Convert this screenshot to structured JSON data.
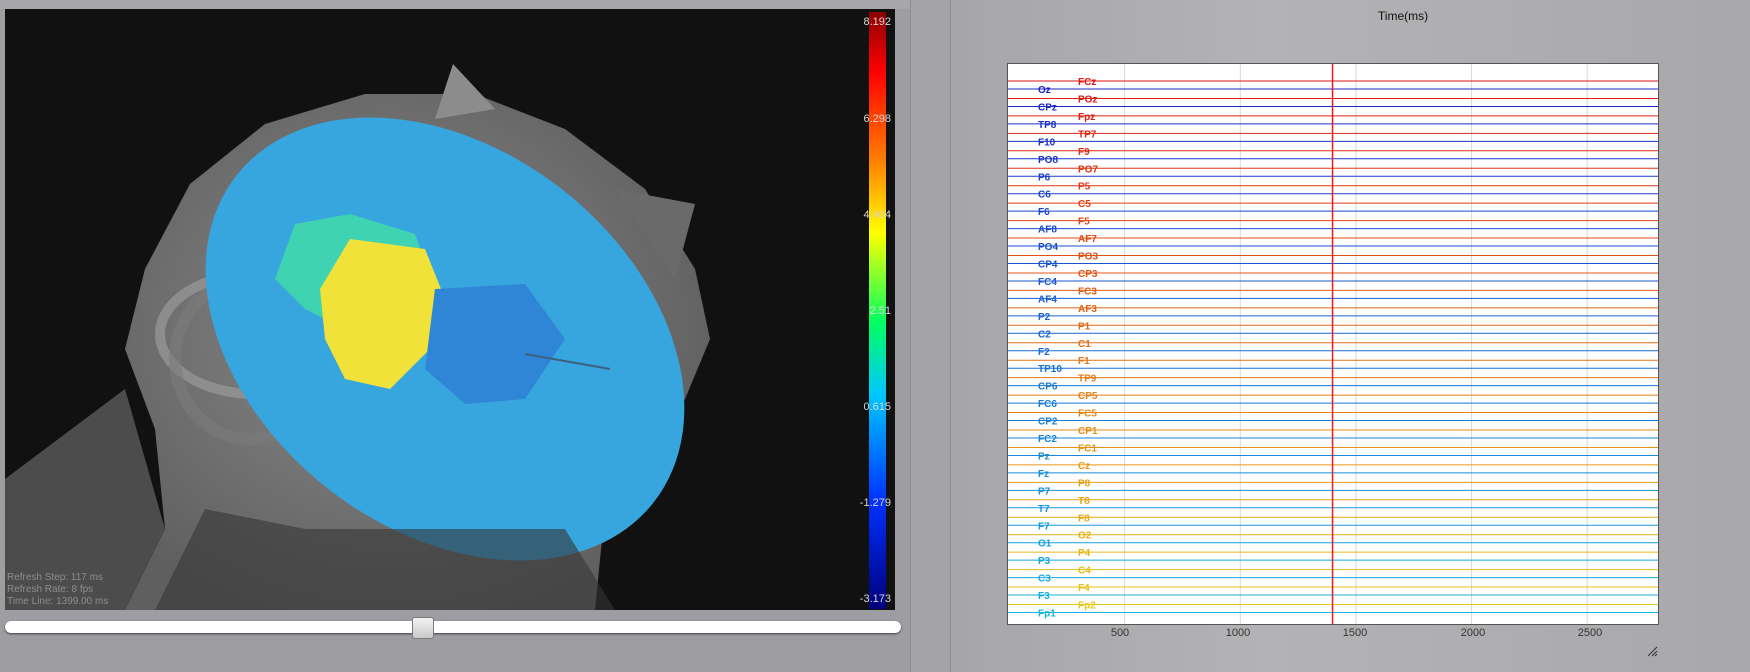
{
  "viewport": {
    "colorbar": {
      "max_label": "8.192",
      "labels": [
        "8.192",
        "6.298",
        "4.404",
        "2.51",
        "0.615",
        "-1.279",
        "-3.173"
      ]
    },
    "info": {
      "refresh_step": "Refresh Step: 117 ms",
      "refresh_rate": "Refresh Rate: 8 fps",
      "time_line": "Time Line: 1399.00 ms"
    }
  },
  "time_slider": {
    "position_fraction": 0.465
  },
  "plot": {
    "title": "Time(ms)",
    "x_ticks": [
      "500",
      "1000",
      "1500",
      "2000",
      "2500"
    ],
    "cursor_ms": 1399,
    "channels_left": [
      "Oz",
      "CPz",
      "TP8",
      "F10",
      "PO8",
      "P6",
      "C6",
      "F6",
      "AF8",
      "PO4",
      "CP4",
      "FC4",
      "AF4",
      "P2",
      "C2",
      "F2",
      "TP10",
      "CP6",
      "FC6",
      "CP2",
      "FC2",
      "Pz",
      "Fz",
      "P7",
      "T7",
      "F7",
      "O1",
      "P3",
      "C3",
      "F3",
      "Fp1"
    ],
    "channels_right": [
      "FCz",
      "POz",
      "Fpz",
      "TP7",
      "F9",
      "PO7",
      "P5",
      "C5",
      "F5",
      "AF7",
      "PO3",
      "CP3",
      "FC3",
      "AF3",
      "P1",
      "C1",
      "F1",
      "TP9",
      "CP5",
      "FC5",
      "CP1",
      "FC1",
      "Cz",
      "P8",
      "T8",
      "F8",
      "O2",
      "P4",
      "C4",
      "F4",
      "Fp2"
    ]
  },
  "colors": {
    "cursor": "#e81c1c",
    "left_label_start": "#1c24c8",
    "left_label_end": "#14b4e0",
    "right_label_start": "#e01414",
    "right_label_end": "#e8c814"
  },
  "icons": {
    "resize": "resize-grip-icon"
  }
}
